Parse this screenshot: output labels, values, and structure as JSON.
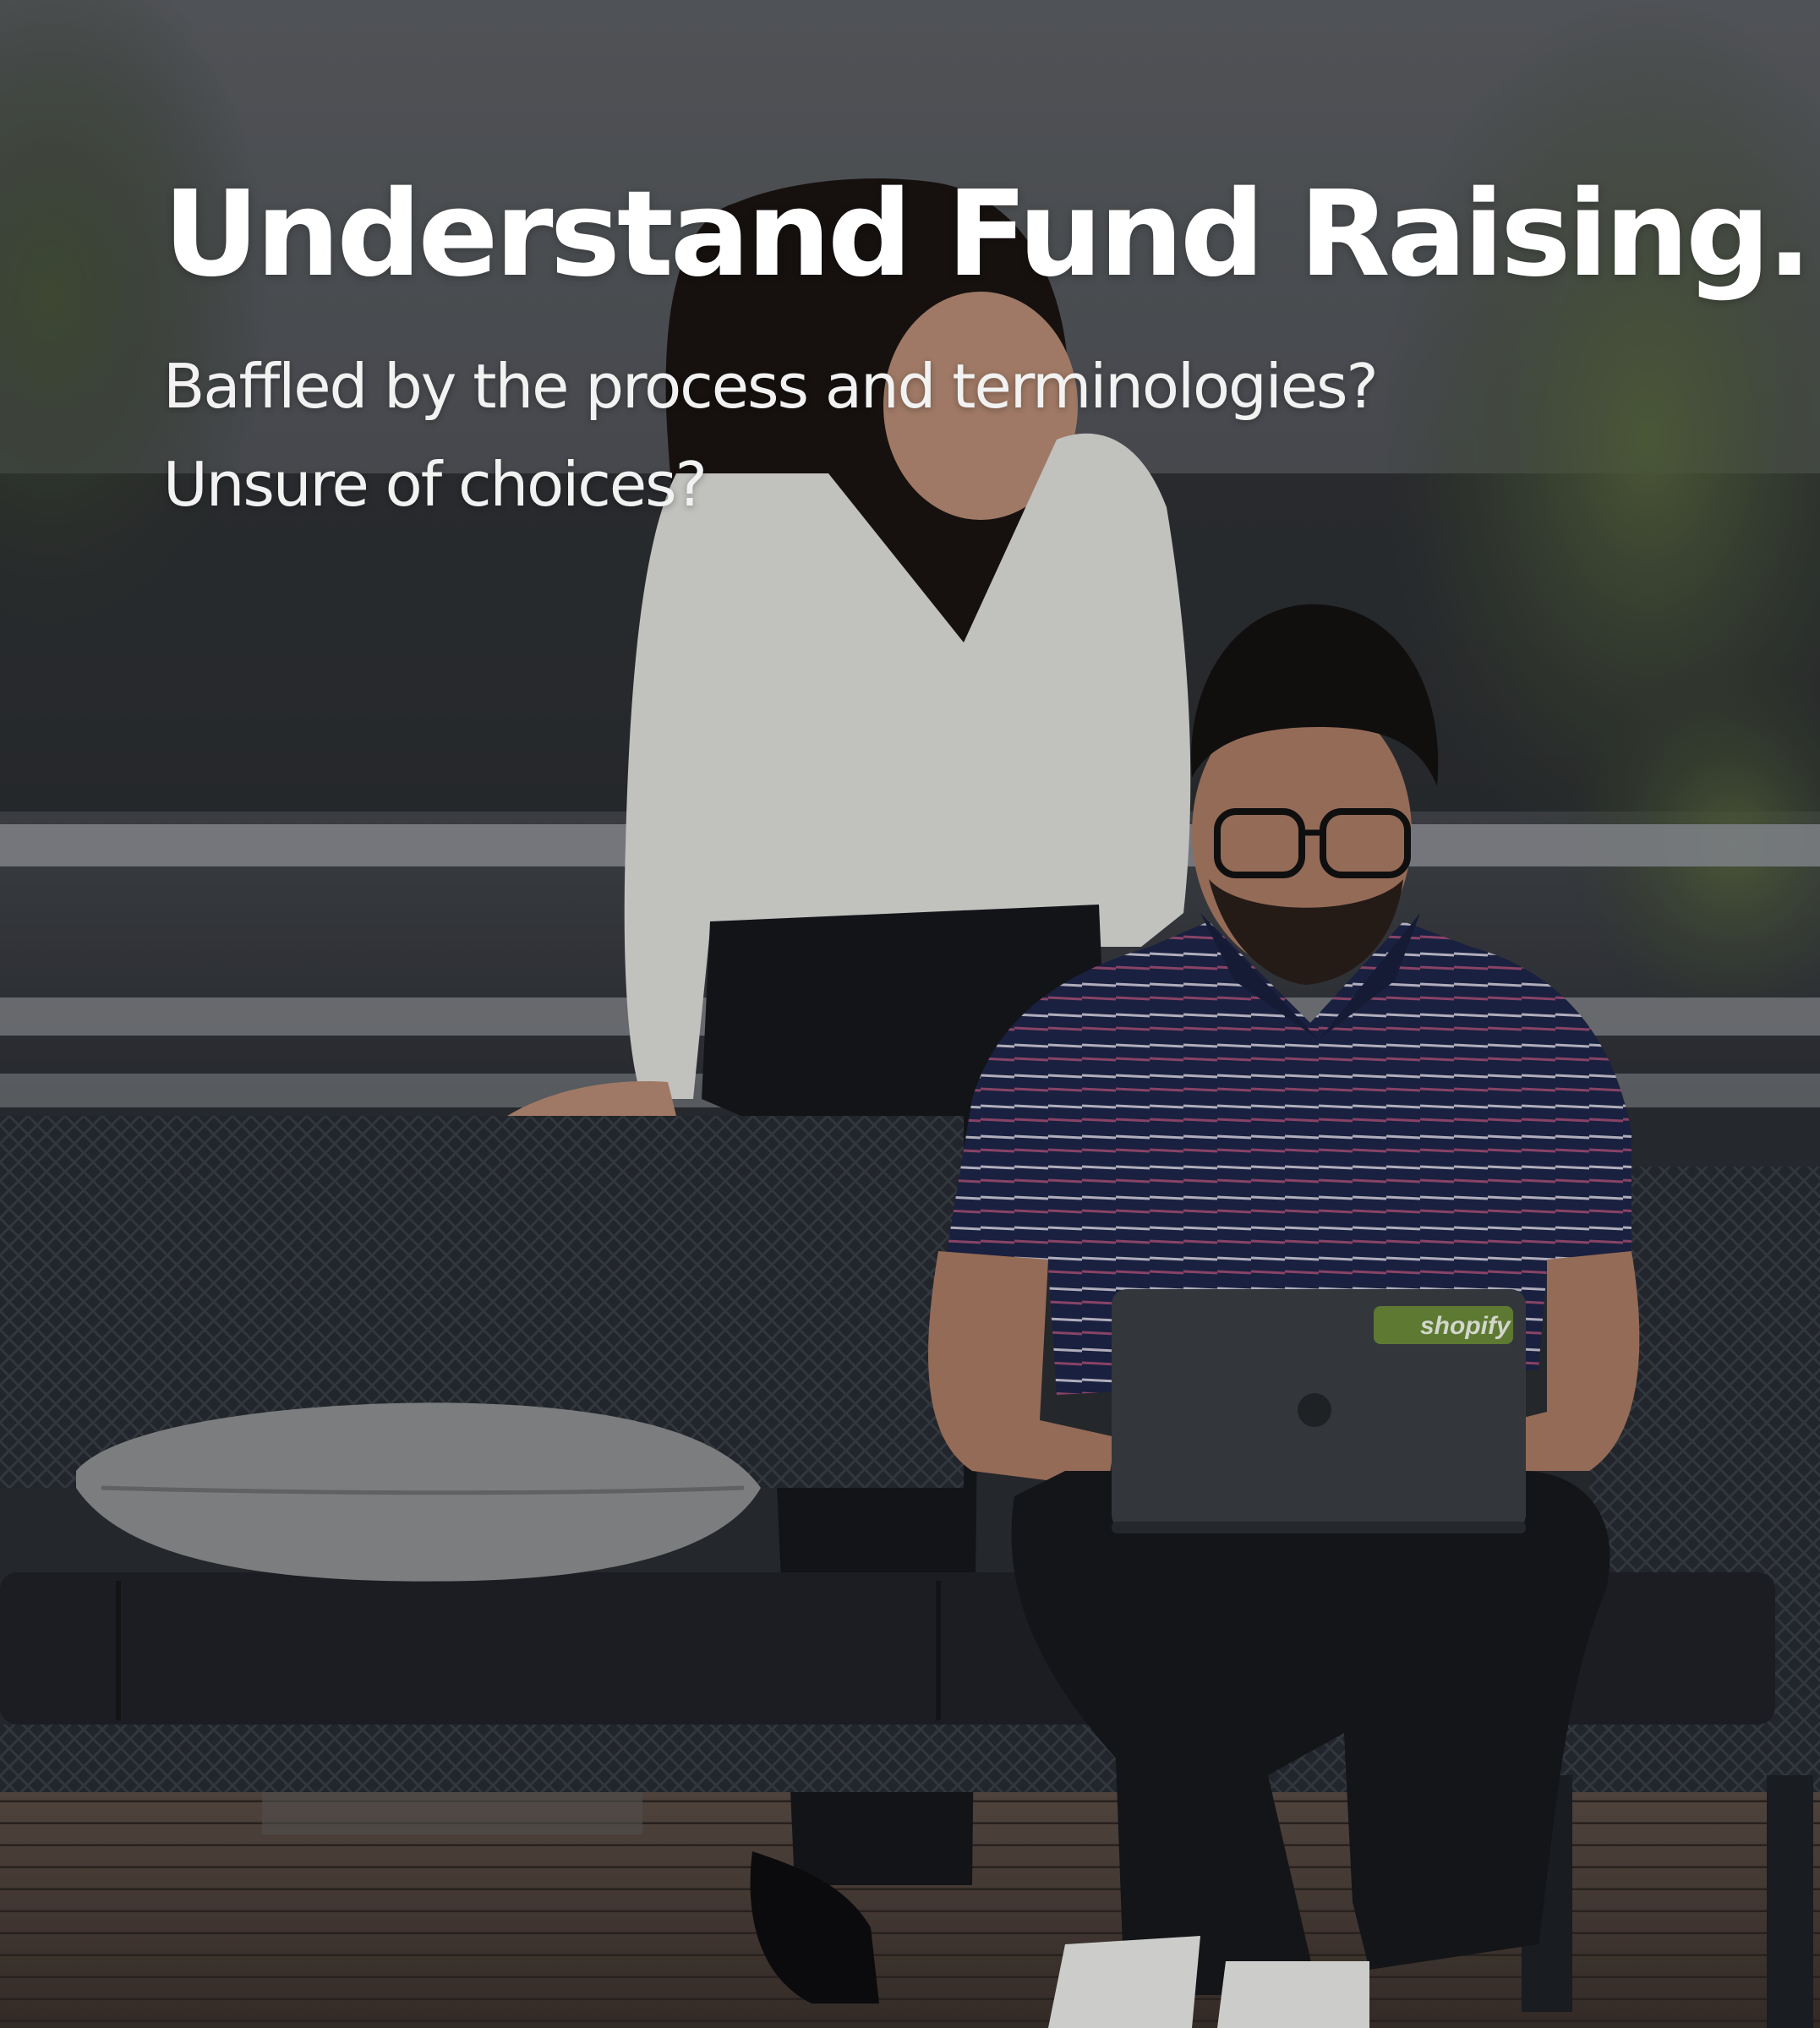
{
  "hero": {
    "headline": "Understand Fund Raising.",
    "subtitle_lines": [
      "Baffled by the process and terminologies?",
      "Unsure of choices?"
    ],
    "image": {
      "laptop_sticker_text": "shopify",
      "colors": {
        "sky": "#55585c",
        "foliage": "#3f4a34",
        "sofa": "#23272c",
        "shirt_navy": "#1c2446",
        "blouse": "#d9d9d6",
        "deck": "#4a3f39"
      }
    }
  }
}
